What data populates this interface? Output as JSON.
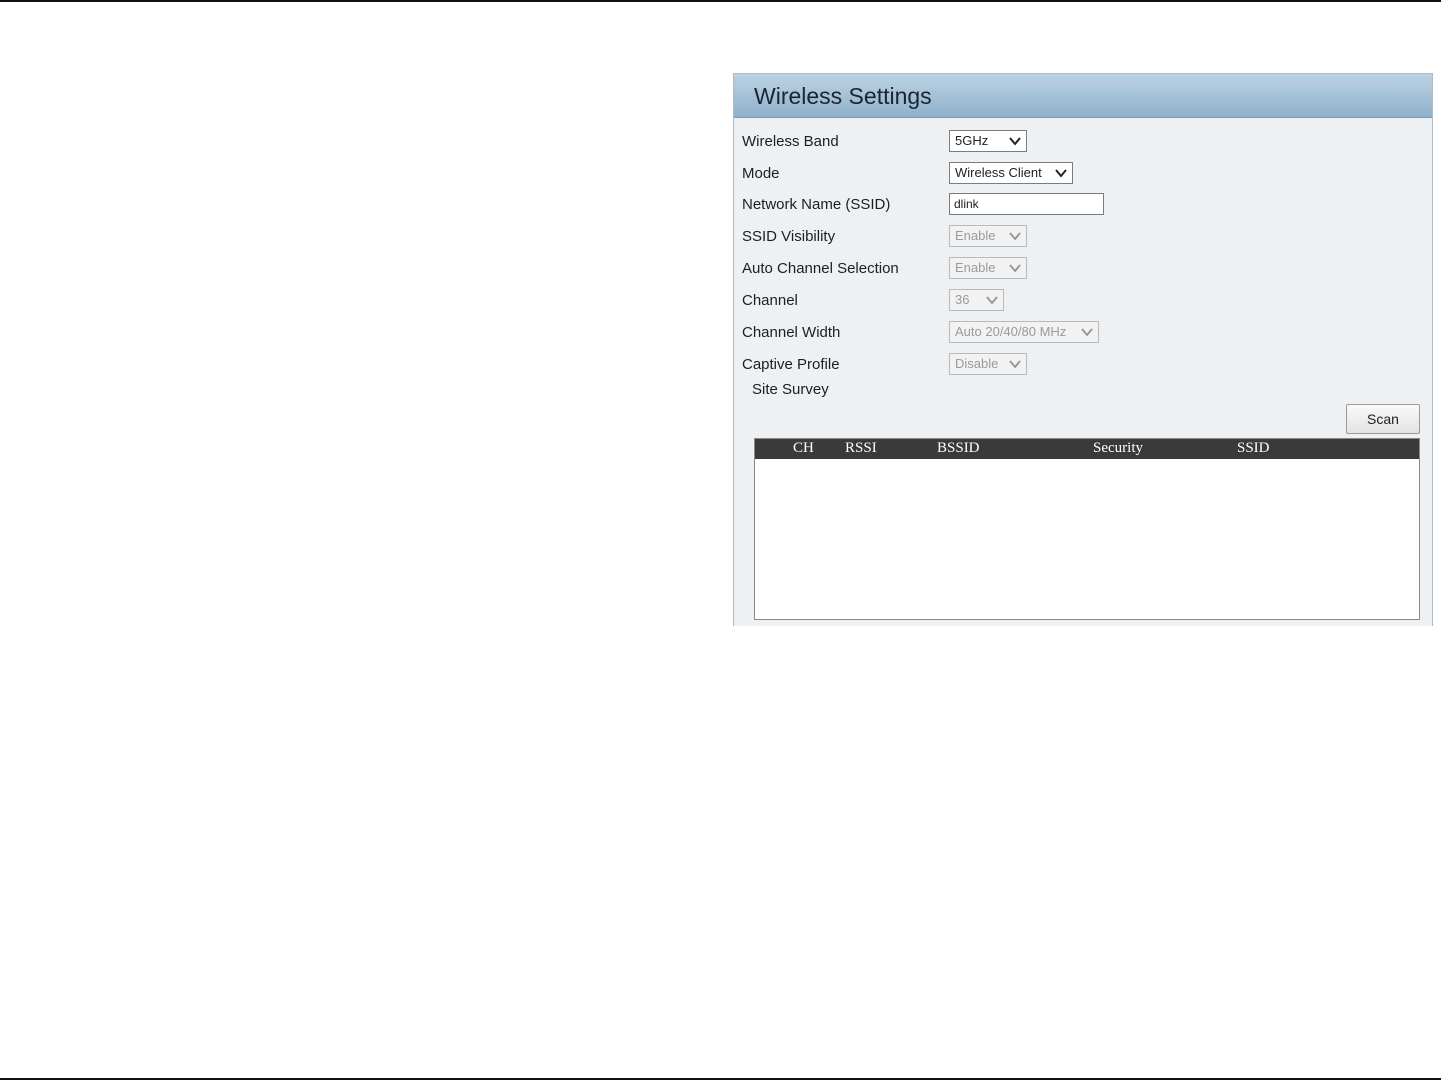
{
  "panel": {
    "title": "Wireless Settings"
  },
  "fields": {
    "wireless_band": {
      "label": "Wireless Band",
      "value": "5GHz"
    },
    "mode": {
      "label": "Mode",
      "value": "Wireless Client"
    },
    "ssid": {
      "label": "Network Name (SSID)",
      "value": "dlink"
    },
    "ssid_visibility": {
      "label": "SSID Visibility",
      "value": "Enable"
    },
    "auto_channel": {
      "label": "Auto Channel Selection",
      "value": "Enable"
    },
    "channel": {
      "label": "Channel",
      "value": "36"
    },
    "channel_width": {
      "label": "Channel Width",
      "value": "Auto 20/40/80 MHz"
    },
    "captive_profile": {
      "label": "Captive Profile",
      "value": "Disable"
    }
  },
  "site_survey": {
    "label": "Site Survey",
    "scan_label": "Scan",
    "columns": [
      "CH",
      "RSSI",
      "BSSID",
      "Security",
      "SSID"
    ],
    "rows": []
  },
  "colors": {
    "header_gradient_top": "#bcd2e3",
    "header_gradient_bottom": "#8fb1cc",
    "panel_background": "#eef1f3",
    "table_header": "#3a3a3a"
  },
  "icons": {
    "dropdown": "chevron-down-icon"
  }
}
